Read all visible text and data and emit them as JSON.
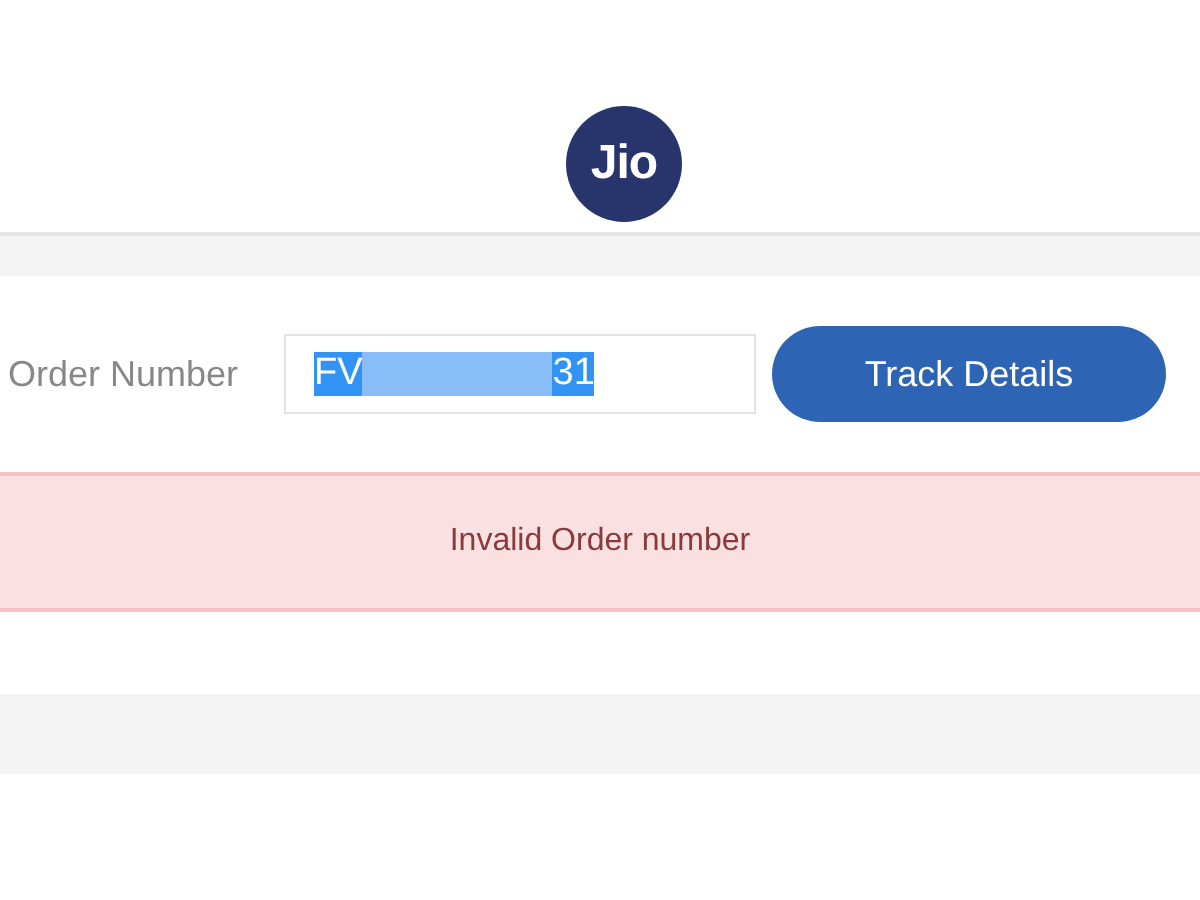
{
  "logo": {
    "text": "Jio"
  },
  "order_form": {
    "label": "Order Number",
    "value_start": "FV",
    "value_end": "31",
    "redacted": true,
    "selected": true,
    "button": "Track Details"
  },
  "alert": {
    "kind": "error",
    "message": "Invalid Order number"
  }
}
